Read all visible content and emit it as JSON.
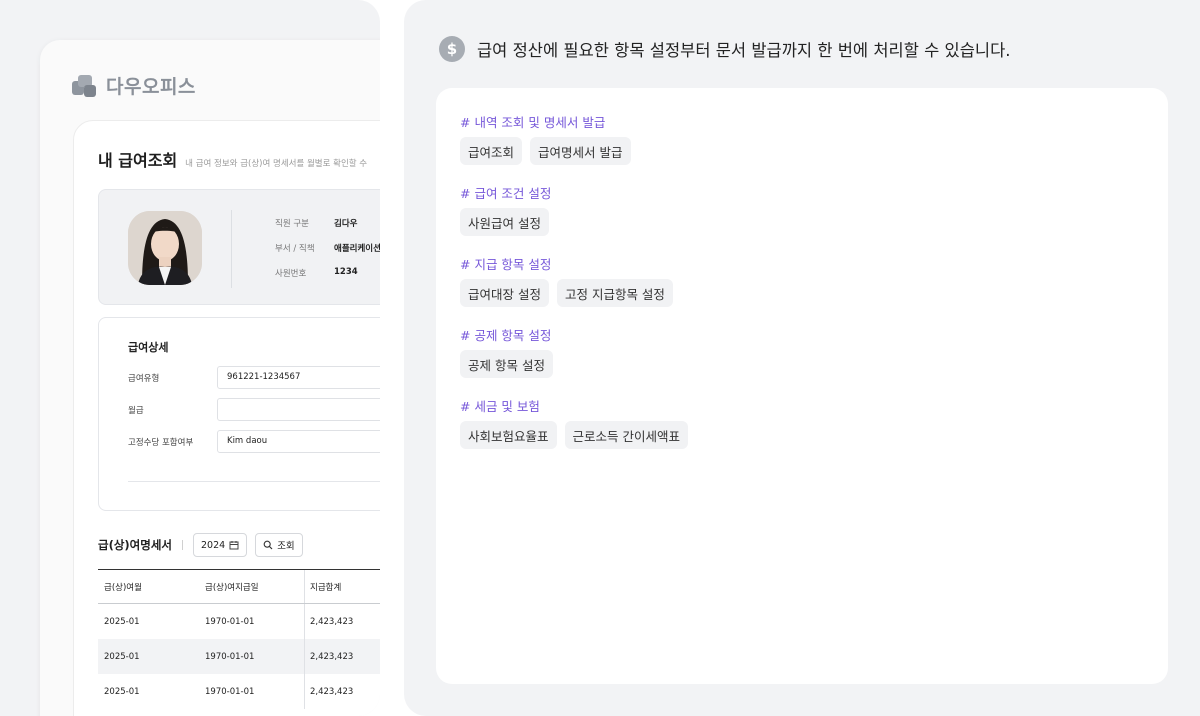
{
  "left": {
    "logo_text": "다우오피스",
    "page_title": "내 급여조회",
    "page_subtitle": "내 급여 정보와 급(상)여 명세서를 월별로 확인할 수",
    "profile": {
      "rows": [
        {
          "label": "직원 구분",
          "value": "김다우"
        },
        {
          "label": "부서 / 직책",
          "value": "애플리케이션"
        },
        {
          "label": "사원번호",
          "value": "1234"
        }
      ]
    },
    "detail": {
      "title": "급여상세",
      "fields": [
        {
          "label": "급여유형",
          "value": "961221-1234567"
        },
        {
          "label": "월급",
          "value": ""
        },
        {
          "label": "고정수당 포함여부",
          "value": "Kim daou"
        }
      ]
    },
    "statement": {
      "title": "급(상)여명세서",
      "year": "2024",
      "search_label": "조회"
    },
    "table": {
      "headers": [
        "급(상)여월",
        "급(상)여지급일",
        "지급합계"
      ],
      "rows": [
        [
          "2025-01",
          "1970-01-01",
          "2,423,423"
        ],
        [
          "2025-01",
          "1970-01-01",
          "2,423,423"
        ],
        [
          "2025-01",
          "1970-01-01",
          "2,423,423"
        ]
      ]
    }
  },
  "right": {
    "headline_icon": "dollar-icon",
    "headline_icon_glyph": "$",
    "headline": "급여 정산에 필요한 항목 설정부터 문서 발급까지 한 번에 처리할 수 있습니다.",
    "accent_color": "#7657d9",
    "sections": [
      {
        "title": "# 내역 조회 및 명세서 발급",
        "chips": [
          "급여조회",
          "급여명세서 발급"
        ]
      },
      {
        "title": "# 급여 조건 설정",
        "chips": [
          "사원급여 설정"
        ]
      },
      {
        "title": "# 지급 항목 설정",
        "chips": [
          "급여대장 설정",
          "고정 지급항목 설정"
        ]
      },
      {
        "title": "# 공제 항목 설정",
        "chips": [
          "공제 항목 설정"
        ]
      },
      {
        "title": "# 세금 및 보험",
        "chips": [
          "사회보험요율표",
          "근로소득 간이세액표"
        ]
      }
    ]
  }
}
